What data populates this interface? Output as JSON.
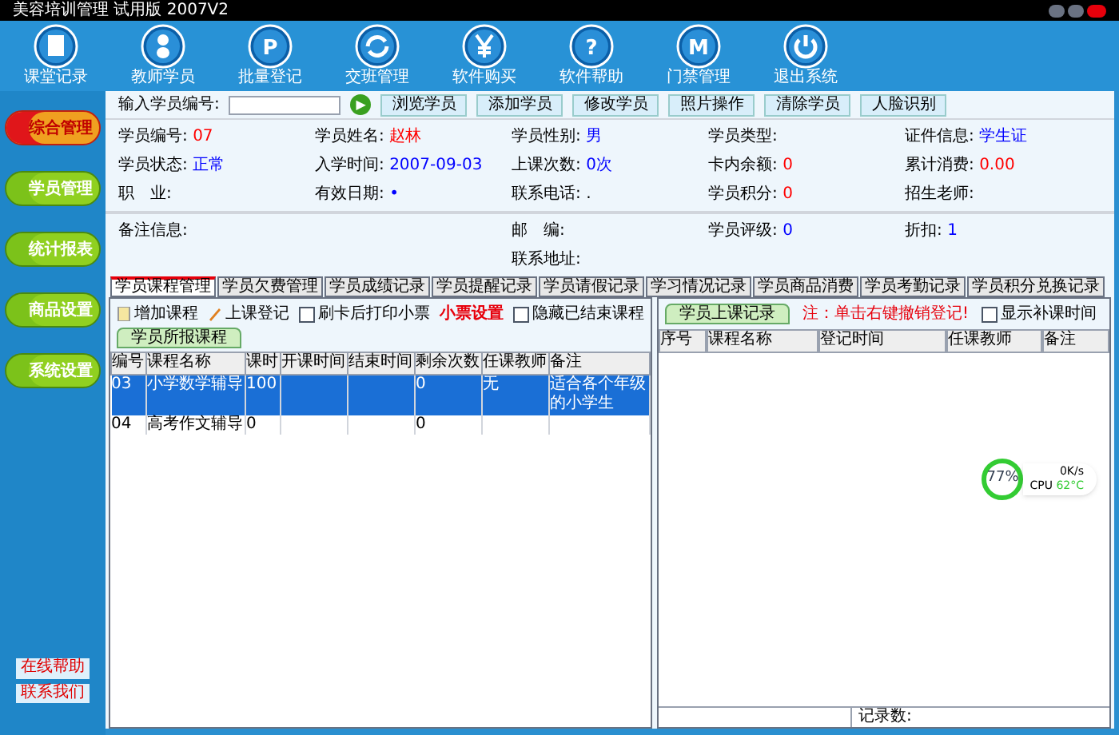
{
  "window": {
    "title": "美容培训管理 试用版 2007V2"
  },
  "toolbar": [
    {
      "label": "课堂记录"
    },
    {
      "label": "教师学员"
    },
    {
      "label": "批量登记",
      "glyph": "P"
    },
    {
      "label": "交班管理"
    },
    {
      "label": "软件购买"
    },
    {
      "label": "软件帮助",
      "glyph": "?"
    },
    {
      "label": "门禁管理",
      "glyph": "M"
    },
    {
      "label": "退出系统"
    }
  ],
  "sidebar": {
    "items": [
      {
        "label": "综合管理",
        "selected": true
      },
      {
        "label": "学员管理",
        "selected": false
      },
      {
        "label": "统计报表",
        "selected": false
      },
      {
        "label": "商品设置",
        "selected": false
      },
      {
        "label": "系统设置",
        "selected": false
      }
    ],
    "footer": [
      "在线帮助",
      "联系我们"
    ]
  },
  "search": {
    "label": "输入学员编号:",
    "go": "▶",
    "buttons": [
      "浏览学员",
      "添加学员",
      "修改学员",
      "照片操作",
      "清除学员",
      "人脸识别"
    ]
  },
  "info": [
    [
      {
        "label": "学员编号:",
        "value": "07",
        "color": "#ff0000"
      },
      {
        "label": "学员姓名:",
        "value": "赵林",
        "color": "#ff0000"
      },
      {
        "label": "学员性别:",
        "value": "男",
        "color": "#0000ff"
      },
      {
        "label": "学员类型:"
      },
      {
        "label": "证件信息:",
        "value": "学生证",
        "color": "#0000ff"
      }
    ],
    [
      {
        "label": "学员状态:",
        "value": "正常",
        "color": "#0000ff"
      },
      {
        "label": "入学时间:",
        "value": "2007-09-03",
        "color": "#0000ff"
      },
      {
        "label": "上课次数:",
        "value": "0次",
        "color": "#0000ff"
      },
      {
        "label": "卡内余额:",
        "value": "0",
        "color": "#ff0000"
      },
      {
        "label": "累计消费:",
        "value": "0.00",
        "color": "#ff0000"
      }
    ],
    [
      {
        "label": "职　业:"
      },
      {
        "label": "有效日期:",
        "value": "•",
        "color": "#0000ff"
      },
      {
        "label": "联系电话:",
        "value": "."
      },
      {
        "label": "学员积分:",
        "value": "0",
        "color": "#ff0000"
      },
      {
        "label": "招生老师:"
      }
    ]
  ],
  "info2": {
    "remarks": {
      "label": "备注信息:"
    },
    "fields": [
      [
        {
          "label": "邮　编:"
        },
        {
          "label": "学员评级:",
          "value": "0",
          "color": "#0000ff"
        },
        {
          "label": "折扣:",
          "value": "1",
          "color": "#0000ff"
        }
      ],
      [
        {
          "label": "联系地址:"
        }
      ]
    ]
  },
  "tabs": [
    {
      "label": "学员课程管理",
      "selected": true
    },
    {
      "label": "学员欠费管理",
      "selected": false
    },
    {
      "label": "学员成绩记录",
      "selected": false
    },
    {
      "label": "学员提醒记录",
      "selected": false
    },
    {
      "label": "学员请假记录",
      "selected": false
    },
    {
      "label": "学习情况记录",
      "selected": false
    },
    {
      "label": "学员商品消费",
      "selected": false
    },
    {
      "label": "学员考勤记录",
      "selected": false
    },
    {
      "label": "学员积分兑换记录",
      "selected": false
    }
  ],
  "courses": {
    "tab": "学员所报课程",
    "add": "增加课程",
    "checkin": "上课登记",
    "print_receipt": {
      "label": "刷卡后打印小票",
      "checked": false
    },
    "receipt_settings": "小票设置",
    "hide_ended": {
      "label": "隐藏已结束课程",
      "checked": false
    },
    "columns": [
      "编号",
      "课程名称",
      "课时",
      "开课时间",
      "结束时间",
      "剩余次数",
      "任课教师",
      "备注"
    ],
    "rows": [
      {
        "selected": true,
        "cells": [
          "03",
          "小学数学辅导",
          "100",
          "",
          "",
          "0",
          "无",
          "适合各个年级的小学生"
        ]
      },
      {
        "selected": false,
        "cells": [
          "04",
          "高考作文辅导",
          "0",
          "",
          "",
          "0",
          "",
          ""
        ]
      }
    ]
  },
  "attendance": {
    "tab": "学员上课记录",
    "note": "注：单击右键撤销登记!",
    "show_makeup": {
      "label": "显示补课时间",
      "checked": false
    },
    "columns": [
      "序号",
      "课程名称",
      "登记时间",
      "任课教师",
      "备注"
    ],
    "footer": "记录数:"
  },
  "monitor": {
    "percent": "77",
    "unit": "%",
    "speed": "0K/s",
    "cpu": "CPU",
    "temp": "62°C"
  }
}
